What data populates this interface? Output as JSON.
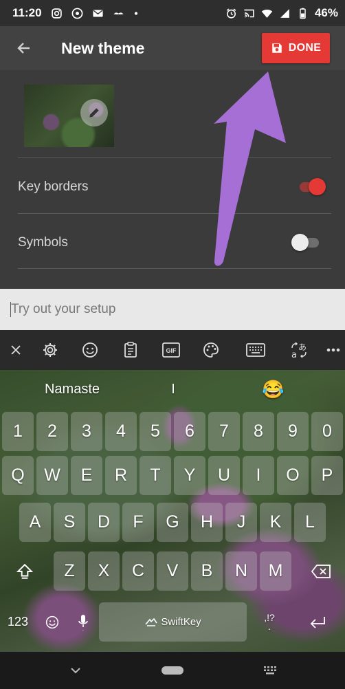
{
  "status_bar": {
    "time": "11:20",
    "battery": "46%"
  },
  "app_bar": {
    "title": "New theme",
    "done_label": "DONE"
  },
  "settings": {
    "key_borders_label": "Key borders",
    "key_borders_on": true,
    "symbols_label": "Symbols",
    "symbols_on": false
  },
  "input": {
    "placeholder": "Try out your setup"
  },
  "keyboard": {
    "predictions": [
      "Namaste",
      "I",
      "😂"
    ],
    "number_row": [
      "1",
      "2",
      "3",
      "4",
      "5",
      "6",
      "7",
      "8",
      "9",
      "0"
    ],
    "row1": [
      "Q",
      "W",
      "E",
      "R",
      "T",
      "Y",
      "U",
      "I",
      "O",
      "P"
    ],
    "row2": [
      "A",
      "S",
      "D",
      "F",
      "G",
      "H",
      "J",
      "K",
      "L"
    ],
    "row3": [
      "Z",
      "X",
      "C",
      "V",
      "B",
      "N",
      "M"
    ],
    "mode_key": "123",
    "punct_key": ",!?",
    "period_key": ".",
    "space_brand": "SwiftKey"
  },
  "colors": {
    "accent_red": "#e53935",
    "annotation_purple": "#a66fd6"
  }
}
